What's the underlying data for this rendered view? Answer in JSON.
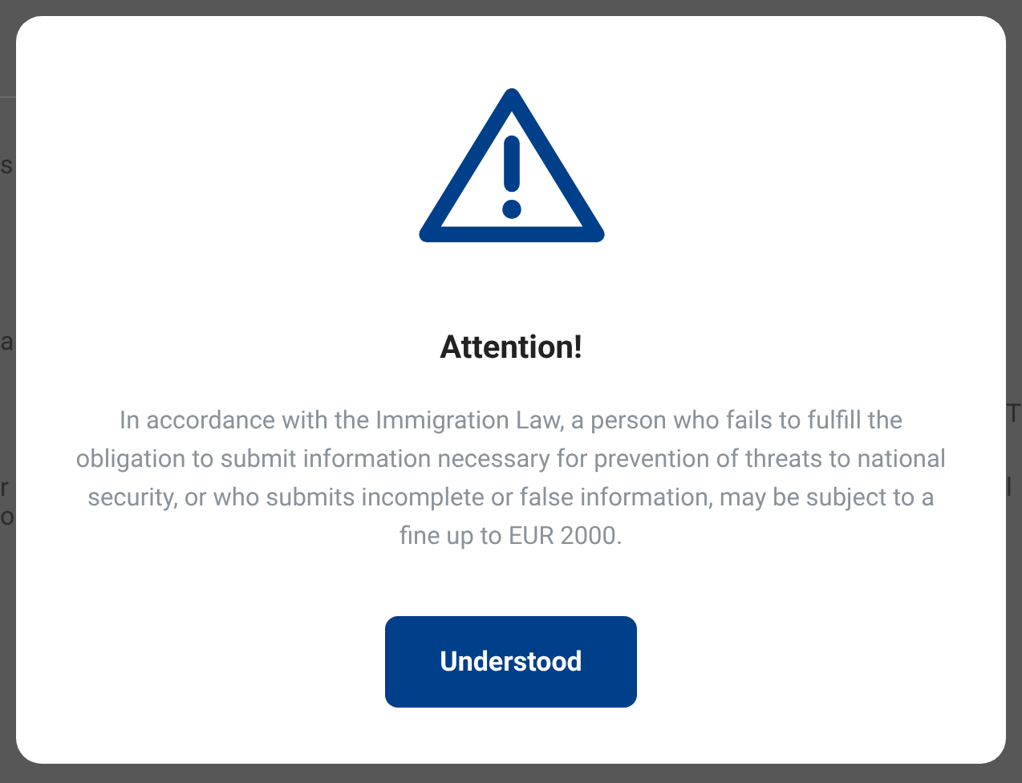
{
  "background": {
    "left_fragments": [
      "s",
      "a",
      "r",
      "o"
    ],
    "right_fragments": [
      "T",
      "l"
    ]
  },
  "dialog": {
    "title": "Attention!",
    "message": "In accordance with the Immigration Law, a person who fails to fulfill the obligation to submit information necessary for prevention of threats to national security, or who submits incomplete or false information, may be subject to a fine up to EUR 2000.",
    "button": "Understood"
  }
}
